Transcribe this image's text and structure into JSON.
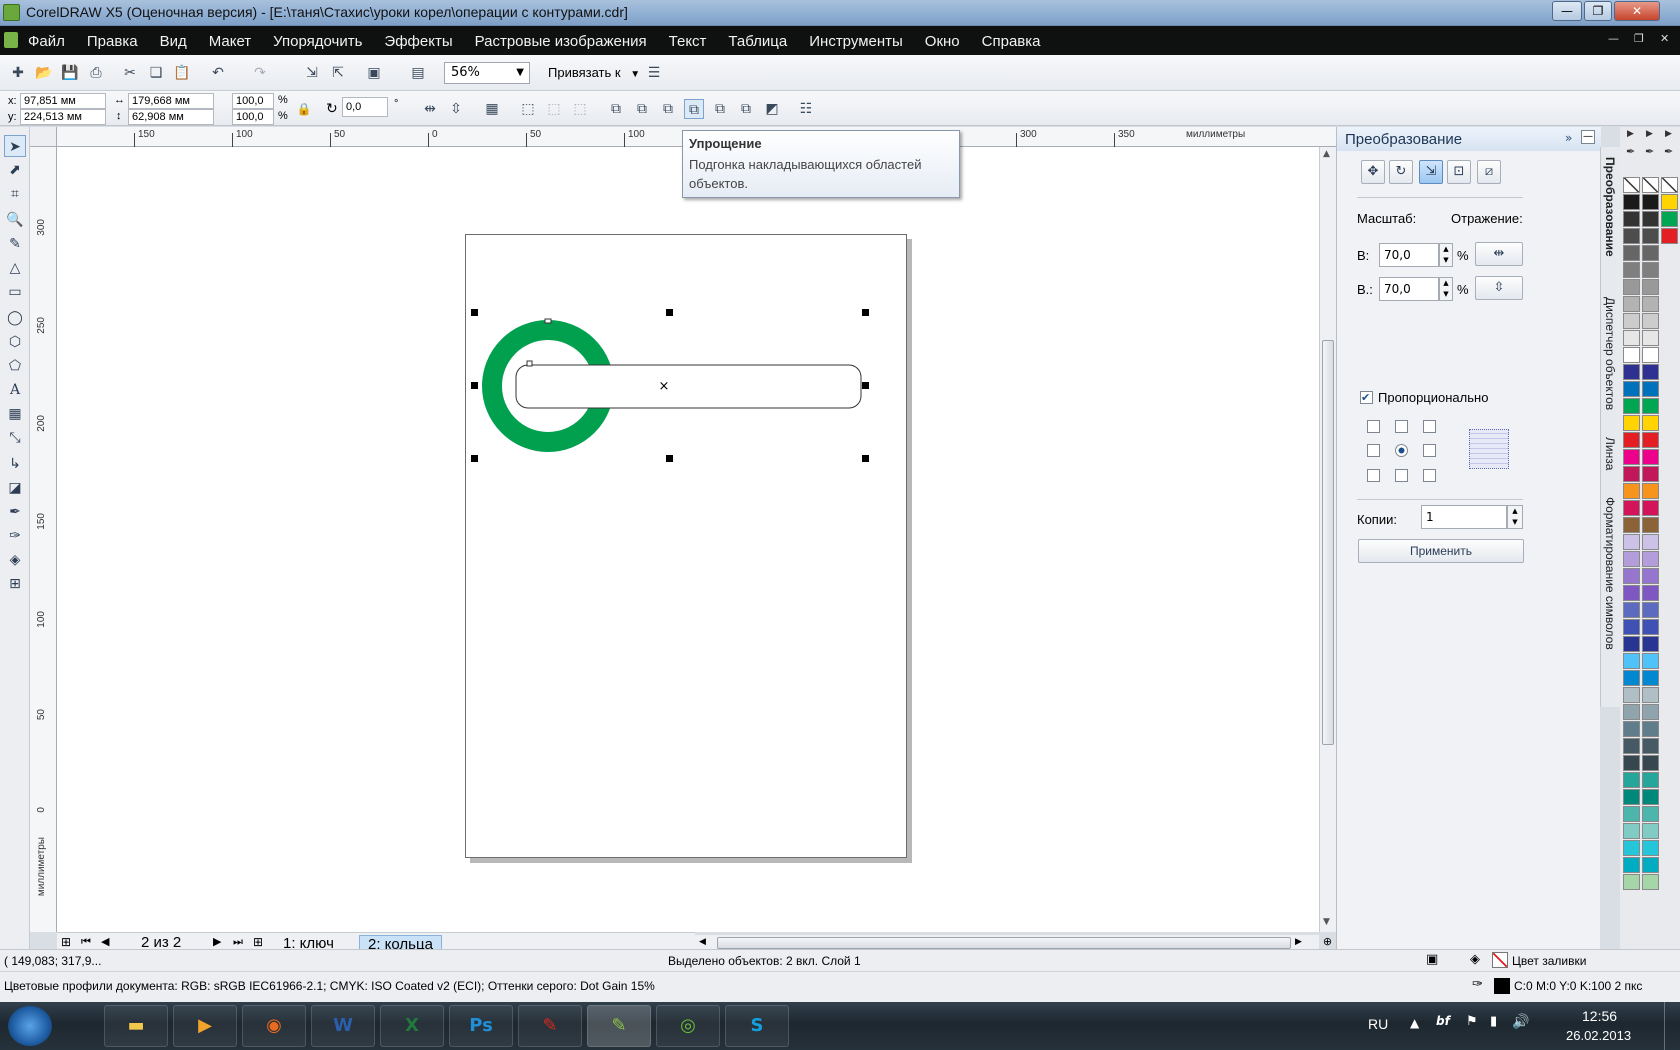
{
  "window": {
    "title": "CorelDRAW X5 (Оценочная версия) - [E:\\таня\\Стахис\\уроки корел\\операции с контурами.cdr]",
    "minimize": "—",
    "restore": "❐",
    "close": "✕"
  },
  "menu": [
    "Файл",
    "Правка",
    "Вид",
    "Макет",
    "Упорядочить",
    "Эффекты",
    "Растровые изображения",
    "Текст",
    "Таблица",
    "Инструменты",
    "Окно",
    "Справка"
  ],
  "toolbar": {
    "zoom": "56%",
    "snap_label": "Привязать к"
  },
  "properties": {
    "x_label": "x:",
    "x_value": "97,851 мм",
    "y_label": "y:",
    "y_value": "224,513 мм",
    "width_value": "179,668 мм",
    "height_value": "62,908 мм",
    "scale_x": "100,0",
    "scale_y": "100,0",
    "percent": "%",
    "angle": "0,0",
    "degree": "°"
  },
  "tooltip": {
    "title": "Упрощение",
    "text": "Подгонка накладывающихся областей объектов."
  },
  "ruler": {
    "units": "миллиметры",
    "h_ticks": [
      "150",
      "100",
      "50",
      "0",
      "50",
      "100",
      "150",
      "200",
      "250",
      "300",
      "350"
    ],
    "v_ticks": [
      "300",
      "250",
      "200",
      "150",
      "100",
      "50",
      "0"
    ]
  },
  "pagenav": {
    "counter": "2 из 2",
    "tabs": [
      "1: ключ",
      "2: кольца"
    ]
  },
  "docker": {
    "title": "Преобразование",
    "scale_label": "Масштаб:",
    "mirror_label": "Отражение:",
    "w_label": "В:",
    "w_value": "70,0",
    "h_label": "В.:",
    "h_value": "70,0",
    "percent": "%",
    "proportional_label": "Пропорционально",
    "copies_label": "Копии:",
    "copies_value": "1",
    "apply_label": "Применить"
  },
  "docker_tabs": [
    "Преобразование",
    "Диспетчер объектов",
    "Линза",
    "Форматирование символов"
  ],
  "palette_colors": [
    [
      "none",
      "none",
      "none"
    ],
    [
      "#1a1a1a",
      "#1a1a1a",
      "#ffd400"
    ],
    [
      "#333333",
      "#333333",
      "#00a651"
    ],
    [
      "#4d4d4d",
      "#4d4d4d",
      "#e31e24"
    ],
    [
      "#666666",
      "#666666",
      ""
    ],
    [
      "#7f7f7f",
      "#7f7f7f",
      ""
    ],
    [
      "#999999",
      "#999999",
      ""
    ],
    [
      "#b3b3b3",
      "#b3b3b3",
      ""
    ],
    [
      "#cccccc",
      "#cccccc",
      ""
    ],
    [
      "#e6e6e6",
      "#e6e6e6",
      ""
    ],
    [
      "#ffffff",
      "#ffffff",
      ""
    ],
    [
      "#2e3192",
      "#2e3192",
      ""
    ],
    [
      "#0072bc",
      "#0072bc",
      ""
    ],
    [
      "#00a651",
      "#00a651",
      ""
    ],
    [
      "#ffd400",
      "#ffd400",
      ""
    ],
    [
      "#e31e24",
      "#e31e24",
      ""
    ],
    [
      "#ec008c",
      "#ec008c",
      ""
    ],
    [
      "#c2185b",
      "#c2185b",
      ""
    ],
    [
      "#f7941d",
      "#f7941d",
      ""
    ],
    [
      "#d4145a",
      "#d4145a",
      ""
    ],
    [
      "#8c6239",
      "#8c6239",
      ""
    ],
    [
      "#ccc1e6",
      "#ccc1e6",
      ""
    ],
    [
      "#b39ddb",
      "#b39ddb",
      ""
    ],
    [
      "#9575cd",
      "#9575cd",
      ""
    ],
    [
      "#7e57c2",
      "#7e57c2",
      ""
    ],
    [
      "#5c6bc0",
      "#5c6bc0",
      ""
    ],
    [
      "#3f51b5",
      "#3f51b5",
      ""
    ],
    [
      "#283593",
      "#283593",
      ""
    ],
    [
      "#4fc3f7",
      "#4fc3f7",
      ""
    ],
    [
      "#0288d1",
      "#0288d1",
      ""
    ],
    [
      "#b0bec5",
      "#b0bec5",
      ""
    ],
    [
      "#90a4ae",
      "#90a4ae",
      ""
    ],
    [
      "#607d8b",
      "#607d8b",
      ""
    ],
    [
      "#455a64",
      "#455a64",
      ""
    ],
    [
      "#37474f",
      "#37474f",
      ""
    ],
    [
      "#26a69a",
      "#26a69a",
      ""
    ],
    [
      "#00897b",
      "#00897b",
      ""
    ],
    [
      "#4db6ac",
      "#4db6ac",
      ""
    ],
    [
      "#80cbc4",
      "#80cbc4",
      ""
    ],
    [
      "#26c6da",
      "#26c6da",
      ""
    ],
    [
      "#00acc1",
      "#00acc1",
      ""
    ],
    [
      "#a5d6a7",
      "#a5d6a7",
      ""
    ]
  ],
  "status": {
    "coords": "( 149,083; 317,9...",
    "selected": "Выделено объектов: 2 вкл. Слой 1",
    "fill_label": "Цвет заливки",
    "profiles": "Цветовые профили документа: RGB: sRGB IEC61966-2.1; CMYK: ISO Coated v2 (ECI); Оттенки серого: Dot Gain 15%",
    "outline": "C:0 M:0 Y:0 K:100  2 пкс"
  },
  "taskbar": {
    "lang": "RU",
    "time": "12:56",
    "date": "26.02.2013",
    "apps": [
      "Проводник",
      "Media",
      "Firefox",
      "Word",
      "Excel",
      "Ps",
      "Acrobat",
      "CorelDRAW",
      "Corel",
      "Skype"
    ]
  },
  "colors": {
    "ring": "#00a04f",
    "menubar": "#0f1010",
    "accent": "#3c7fb1"
  }
}
